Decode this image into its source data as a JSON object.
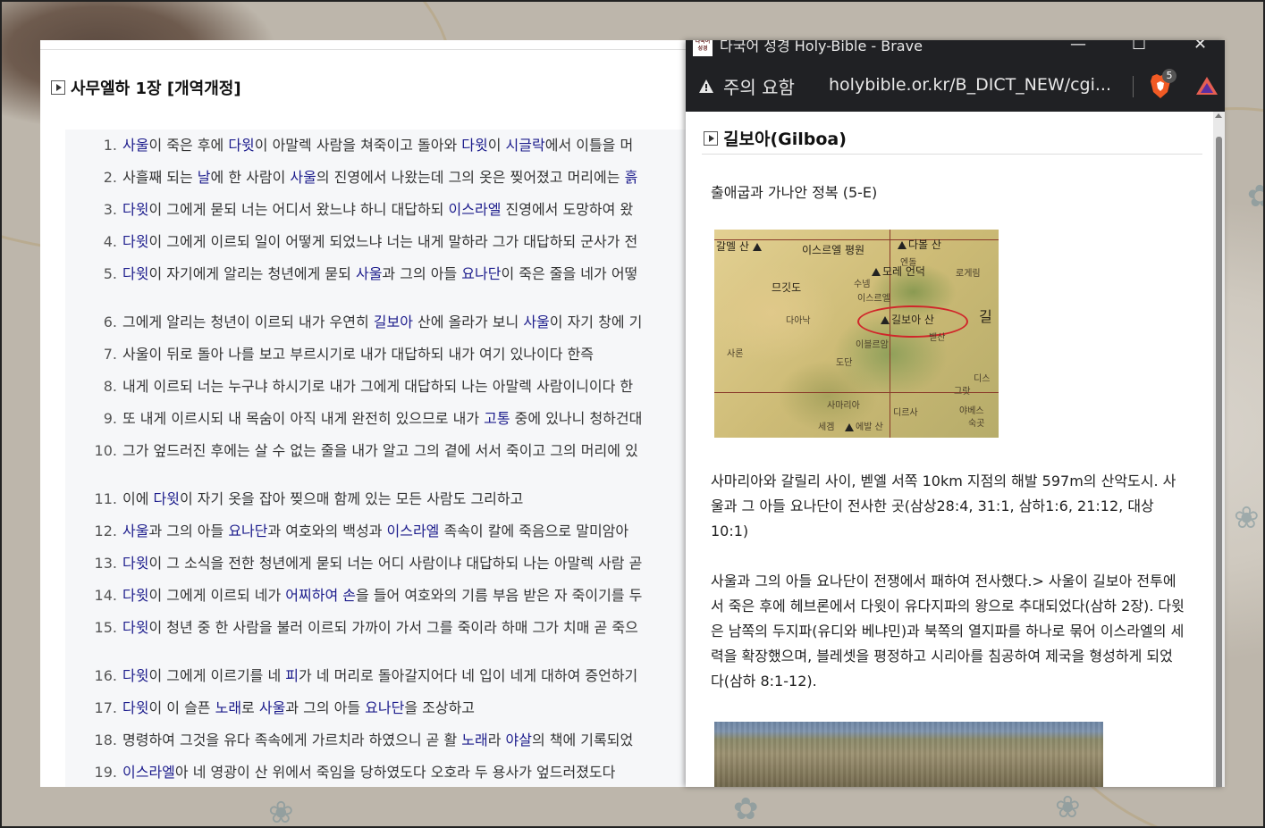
{
  "left_page": {
    "heading": "사무엘하 1장 [개역개정]",
    "verses": [
      {
        "num": "1.",
        "parts": [
          {
            "t": "사울",
            "link": true
          },
          {
            "t": "이 죽은 후에 "
          },
          {
            "t": "다윗",
            "link": true
          },
          {
            "t": "이 아말렉 사람을 쳐죽이고 돌아와 "
          },
          {
            "t": "다윗",
            "link": true
          },
          {
            "t": "이 "
          },
          {
            "t": "시글락",
            "link": true
          },
          {
            "t": "에서 이틀을 머"
          }
        ]
      },
      {
        "num": "2.",
        "parts": [
          {
            "t": "사흘째 되는 "
          },
          {
            "t": "날",
            "link": true
          },
          {
            "t": "에 한 사람이 "
          },
          {
            "t": "사울",
            "link": true
          },
          {
            "t": "의 진영에서 나왔는데 그의 옷은 찢어졌고 머리에는 "
          },
          {
            "t": "흙",
            "link": true
          }
        ]
      },
      {
        "num": "3.",
        "parts": [
          {
            "t": "다윗",
            "link": true
          },
          {
            "t": "이 그에게 묻되 너는 어디서 왔느냐 하니 대답하되 "
          },
          {
            "t": "이스라엘",
            "link": true
          },
          {
            "t": " 진영에서 도망하여 왔"
          }
        ]
      },
      {
        "num": "4.",
        "parts": [
          {
            "t": "다윗",
            "link": true
          },
          {
            "t": "이 그에게 이르되 일이 어떻게 되었느냐 너는 내게 말하라 그가 대답하되 군사가 전"
          }
        ]
      },
      {
        "num": "5.",
        "parts": [
          {
            "t": "다윗",
            "link": true
          },
          {
            "t": "이 자기에게 알리는 청년에게 묻되 "
          },
          {
            "t": "사울",
            "link": true
          },
          {
            "t": "과 그의 아들 "
          },
          {
            "t": "요나단",
            "link": true
          },
          {
            "t": "이 죽은 줄을 네가 어떻"
          }
        ]
      },
      {
        "num": "6.",
        "parts": [
          {
            "t": "그에게 알리는 청년이 이르되 내가 우연히 "
          },
          {
            "t": "길보아",
            "link": true
          },
          {
            "t": " 산에 올라가 보니 "
          },
          {
            "t": "사울",
            "link": true
          },
          {
            "t": "이 자기 창에 기"
          }
        ]
      },
      {
        "num": "7.",
        "parts": [
          {
            "t": "사울이 뒤로 돌아 나를 보고 부르시기로 내가 대답하되 내가 여기 있나이다 한즉"
          }
        ]
      },
      {
        "num": "8.",
        "parts": [
          {
            "t": "내게 이르되 너는 누구냐 하시기로 내가 그에게 대답하되 나는 아말렉 사람이니이다 한"
          }
        ]
      },
      {
        "num": "9.",
        "parts": [
          {
            "t": "또 내게 이르시되 내 목숨이 아직 내게 완전히 있으므로 내가 "
          },
          {
            "t": "고통",
            "link": true
          },
          {
            "t": " 중에 있나니 청하건대"
          }
        ]
      },
      {
        "num": "10.",
        "parts": [
          {
            "t": "그가 엎드러진 후에는 살 수 없는 줄을 내가 알고 그의 곁에 서서 죽이고 그의 머리에 있"
          }
        ]
      },
      {
        "num": "11.",
        "parts": [
          {
            "t": "이에 "
          },
          {
            "t": "다윗",
            "link": true
          },
          {
            "t": "이 자기 옷을 잡아 찢으매 함께 있는 모든 사람도 그리하고"
          }
        ]
      },
      {
        "num": "12.",
        "parts": [
          {
            "t": "사울",
            "link": true
          },
          {
            "t": "과 그의 아들 "
          },
          {
            "t": "요나단",
            "link": true
          },
          {
            "t": "과 여호와의 백성과 "
          },
          {
            "t": "이스라엘",
            "link": true
          },
          {
            "t": " 족속이 칼에 죽음으로 말미암아"
          }
        ]
      },
      {
        "num": "13.",
        "parts": [
          {
            "t": "다윗",
            "link": true
          },
          {
            "t": "이 그 소식을 전한 청년에게 묻되 너는 어디 사람이냐 대답하되 나는 아말렉 사람 곧"
          }
        ]
      },
      {
        "num": "14.",
        "parts": [
          {
            "t": "다윗",
            "link": true
          },
          {
            "t": "이 그에게 이르되 네가 "
          },
          {
            "t": "어찌하여",
            "link": true
          },
          {
            "t": " "
          },
          {
            "t": "손",
            "link": true
          },
          {
            "t": "을 들어 여호와의 기름 부음 받은 자 죽이기를 두"
          }
        ]
      },
      {
        "num": "15.",
        "parts": [
          {
            "t": "다윗",
            "link": true
          },
          {
            "t": "이 청년 중 한 사람을 불러 이르되 가까이 가서 그를 죽이라 하매 그가 치매 곧 죽으"
          }
        ]
      },
      {
        "num": "16.",
        "parts": [
          {
            "t": "다윗",
            "link": true
          },
          {
            "t": "이 그에게 이르기를 네 "
          },
          {
            "t": "피",
            "link": true
          },
          {
            "t": "가 네 머리로 돌아갈지어다 네 입이 네게 대하여 증언하기"
          }
        ]
      },
      {
        "num": "17.",
        "parts": [
          {
            "t": "다윗",
            "link": true
          },
          {
            "t": "이 이 슬픈 "
          },
          {
            "t": "노래",
            "link": true
          },
          {
            "t": "로 "
          },
          {
            "t": "사울",
            "link": true
          },
          {
            "t": "과 그의 아들 "
          },
          {
            "t": "요나단",
            "link": true
          },
          {
            "t": "을 조상하고"
          }
        ]
      },
      {
        "num": "18.",
        "parts": [
          {
            "t": "명령하여 그것을 유다 족속에게 가르치라 하였으니 곧 활 "
          },
          {
            "t": "노래",
            "link": true
          },
          {
            "t": "라 "
          },
          {
            "t": "야살",
            "link": true
          },
          {
            "t": "의 책에 기록되었"
          }
        ]
      },
      {
        "num": "19.",
        "parts": [
          {
            "t": "이스라엘",
            "link": true
          },
          {
            "t": "아 네 영광이 산 위에서 죽임을 당하였도다 오호라 두 용사가 엎드러졌도다"
          }
        ]
      }
    ]
  },
  "popup": {
    "favicon_text": "다국어 성경",
    "window_title": "다국어 성경 Holy-Bible - Brave",
    "window_controls": {
      "minimize": "—",
      "maximize": "☐",
      "close": "✕"
    },
    "security_label": "주의 요함",
    "url": "holybible.or.kr/B_DICT_NEW/cgi...",
    "shields_badge": "5",
    "entry_title": "길보아(Gilboa)",
    "map_caption": "출애굽과 가나안 정복 (5-E)",
    "map_labels": {
      "carmel": "갈멜 산",
      "jezreel_plain": "이스르엘 평원",
      "tabor": "다볼 산",
      "endor": "엔돌",
      "moreh": "모레 언덕",
      "shunem": "수넴",
      "megiddo": "므깃도",
      "jezreel": "이스르엘",
      "taanach": "다아낙",
      "gilboa": "길보아 산",
      "gil": "길",
      "bethshan": "벧산",
      "ibleam": "이블르암",
      "sharon": "사론",
      "dothan": "도단",
      "samaria": "사마리아",
      "tirzah": "디르사",
      "shechem": "세겜",
      "ebal": "에발 산",
      "gerasa_left": "로게림",
      "dies": "디스",
      "gora": "그랏",
      "jabesh": "야베스",
      "sukkot": "숙곳"
    },
    "paragraph1": "사마리아와 갈릴리 사이, 벧엘 서쪽 10km 지점의 해발 597m의 산악도시. 사울과 그 아들 요나단이 전사한 곳(삼상28:4, 31:1, 삼하1:6, 21:12, 대상10:1)",
    "paragraph2": "사울과 그의 아들 요나단이 전쟁에서 패하여 전사했다.> 사울이 길보아 전투에서 죽은 후에 헤브론에서 다윗이 유다지파의 왕으로 추대되었다(삼하 2장). 다윗은 남쪽의 두지파(유디와 베냐민)과 북쪽의 열지파를 하나로 묶어 이스라엘의 세력을 확장했으며, 블레셋을 평정하고 시리아를 침공하여 제국을 형성하게 되었다(삼하 8:1-12)."
  },
  "colors": {
    "link": "#1c1c8c",
    "titlebar": "#202124",
    "verse_bg": "#f6f7f9"
  }
}
